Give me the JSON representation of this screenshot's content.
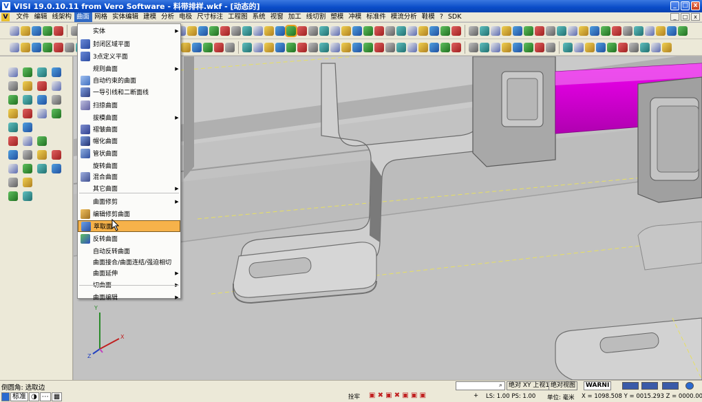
{
  "window": {
    "title": "VISI 19.0.10.11 from Vero Software - 料带排样.wkf - [动态的]",
    "minimize": "_",
    "maximize": "□",
    "close": "x",
    "logo": "V"
  },
  "menubar": {
    "items": [
      "文件",
      "编辑",
      "线架构",
      "曲面",
      "网格",
      "实体编辑",
      "建模",
      "分析",
      "电极",
      "尺寸标注",
      "工程图",
      "系统",
      "视窗",
      "加工",
      "线切割",
      "塑模",
      "冲模",
      "标准件",
      "模流分析",
      "鞋模",
      "?",
      "SDK"
    ],
    "active": "曲面",
    "mdi_buttons": [
      "_",
      "□",
      "x"
    ]
  },
  "surface_menu": {
    "items": [
      {
        "label": "实体",
        "submenu": true,
        "icon": "none"
      },
      {
        "label": "封闭区域平面",
        "submenu": false,
        "icon": "plane-icon"
      },
      {
        "label": "3点定义平面",
        "submenu": false,
        "icon": "three-point-plane-icon"
      },
      {
        "label": "规则曲面",
        "submenu": true,
        "icon": "none"
      },
      {
        "label": "自动约束的曲面",
        "submenu": false,
        "icon": "auto-surface-icon"
      },
      {
        "label": "一导引线和二断面线",
        "submenu": false,
        "icon": "guide-section-icon"
      },
      {
        "label": "扫掠曲面",
        "submenu": false,
        "icon": "sweep-icon"
      },
      {
        "label": "拔模曲面",
        "submenu": true,
        "icon": "none"
      },
      {
        "label": "褶皱曲面",
        "submenu": false,
        "icon": "wrinkle-icon"
      },
      {
        "label": "帽化曲面",
        "submenu": false,
        "icon": "cap-icon"
      },
      {
        "label": "管状曲面",
        "submenu": false,
        "icon": "tube-icon"
      },
      {
        "label": "旋转曲面",
        "submenu": false,
        "icon": "none"
      },
      {
        "label": "混合曲面",
        "submenu": false,
        "icon": "blend-icon"
      },
      {
        "label": "其它曲面",
        "submenu": true,
        "icon": "none"
      },
      {
        "label": "曲面修剪",
        "submenu": true,
        "icon": "none"
      },
      {
        "label": "编辑修剪曲面",
        "submenu": false,
        "icon": "edit-trim-icon"
      },
      {
        "label": "萃取面",
        "submenu": false,
        "icon": "extract-face-icon",
        "highlighted": true
      },
      {
        "label": "反转曲面",
        "submenu": false,
        "icon": "flip-surface-icon"
      },
      {
        "label": "自动反转曲面",
        "submenu": false,
        "icon": "none"
      },
      {
        "label": "曲面接合/曲面连结/强迫相切",
        "submenu": false,
        "icon": "none"
      },
      {
        "label": "曲面延伸",
        "submenu": true,
        "icon": "none"
      },
      {
        "label": "切曲面",
        "submenu": true,
        "icon": "none"
      },
      {
        "label": "曲面编辑",
        "submenu": true,
        "icon": "none"
      }
    ],
    "submenu_arrow": "▶"
  },
  "statusbar": {
    "prompt": "倒圆角: 选取边",
    "search_icon": "search-icon",
    "view1": "绝对 XY 上视1",
    "view2": "绝对视图",
    "warn": "WARNI",
    "standard": "标准",
    "weld": "拴牢",
    "ls_ps": "LS: 1.00 PS: 1.00",
    "unit": "单位: 毫米",
    "coords": "X = 1098.508 Y = 0015.293 Z = 0000.000",
    "plus": "+"
  },
  "axis_triad": {
    "x_label": "X",
    "y_label": "Y",
    "z_label": "Z"
  },
  "colors": {
    "title_blue": "#0a4cc8",
    "menu_highlight": "#f6b24a",
    "magenta_part": "#e800e8",
    "cursor_halo": "#f8f020"
  }
}
